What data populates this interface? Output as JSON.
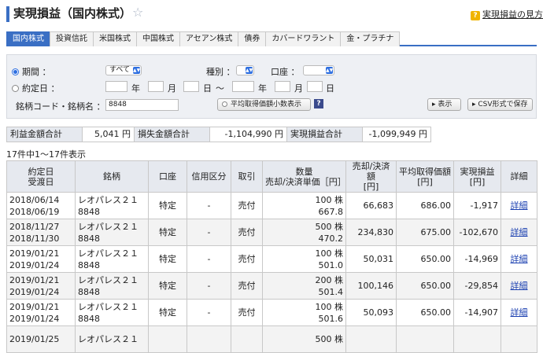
{
  "header": {
    "title": "実現損益（国内株式）",
    "help_label": "実現損益の見方"
  },
  "tabs": [
    "国内株式",
    "投資信託",
    "米国株式",
    "中国株式",
    "アセアン株式",
    "債券",
    "カバードワラント",
    "金・プラチナ"
  ],
  "filter": {
    "period_label": "期間 ：",
    "period_value": "すべて",
    "contract_date_label": "約定日 ：",
    "year_label": "年",
    "month_label": "月",
    "day_label": "日",
    "tilde": "〜",
    "type_label": "種別 ：",
    "account_label": "口座 ：",
    "code_label": "銘柄コード・銘柄名 ：",
    "code_value": "8848",
    "avg_button": "平均取得価額小数表示",
    "help_q": "?",
    "show_button": "表示",
    "csv_button": "CSV形式で保存"
  },
  "summary": {
    "profit_label": "利益金額合計",
    "profit_value": "5,041 円",
    "loss_label": "損失金額合計",
    "loss_value": "-1,104,990 円",
    "realized_label": "実現損益合計",
    "realized_value": "-1,099,949 円"
  },
  "count_text": "17件中1〜17件表示",
  "table": {
    "headers": {
      "date": [
        "約定日",
        "受渡日"
      ],
      "name": "銘柄",
      "account": "口座",
      "credit": "信用区分",
      "trade": "取引",
      "qty": [
        "数量",
        "売却/決済単価［円］"
      ],
      "proceeds": [
        "売却/決済額",
        "[円]"
      ],
      "avg": [
        "平均取得価額",
        "[円]"
      ],
      "pl": [
        "実現損益",
        "[円]"
      ],
      "detail": "詳細"
    },
    "rows": [
      {
        "date1": "2018/06/14",
        "date2": "2018/06/19",
        "name": "レオパレス２１",
        "code": "8848",
        "account": "特定",
        "credit": "-",
        "trade": "売付",
        "qty": "100 株",
        "price": "667.8",
        "proceeds": "66,683",
        "avg": "686.00",
        "pl": "-1,917",
        "detail": "詳細"
      },
      {
        "date1": "2018/11/27",
        "date2": "2018/11/30",
        "name": "レオパレス２１",
        "code": "8848",
        "account": "特定",
        "credit": "-",
        "trade": "売付",
        "qty": "500 株",
        "price": "470.2",
        "proceeds": "234,830",
        "avg": "675.00",
        "pl": "-102,670",
        "detail": "詳細"
      },
      {
        "date1": "2019/01/21",
        "date2": "2019/01/24",
        "name": "レオパレス２１",
        "code": "8848",
        "account": "特定",
        "credit": "-",
        "trade": "売付",
        "qty": "100 株",
        "price": "501.0",
        "proceeds": "50,031",
        "avg": "650.00",
        "pl": "-14,969",
        "detail": "詳細"
      },
      {
        "date1": "2019/01/21",
        "date2": "2019/01/24",
        "name": "レオパレス２１",
        "code": "8848",
        "account": "特定",
        "credit": "-",
        "trade": "売付",
        "qty": "200 株",
        "price": "501.4",
        "proceeds": "100,146",
        "avg": "650.00",
        "pl": "-29,854",
        "detail": "詳細"
      },
      {
        "date1": "2019/01/21",
        "date2": "2019/01/24",
        "name": "レオパレス２１",
        "code": "8848",
        "account": "特定",
        "credit": "-",
        "trade": "売付",
        "qty": "100 株",
        "price": "501.6",
        "proceeds": "50,093",
        "avg": "650.00",
        "pl": "-14,907",
        "detail": "詳細"
      },
      {
        "date1": "2019/01/25",
        "date2": "",
        "name": "レオパレス２１",
        "code": "",
        "account": "",
        "credit": "",
        "trade": "",
        "qty": "500 株",
        "price": "",
        "proceeds": "",
        "avg": "",
        "pl": "",
        "detail": ""
      }
    ]
  }
}
